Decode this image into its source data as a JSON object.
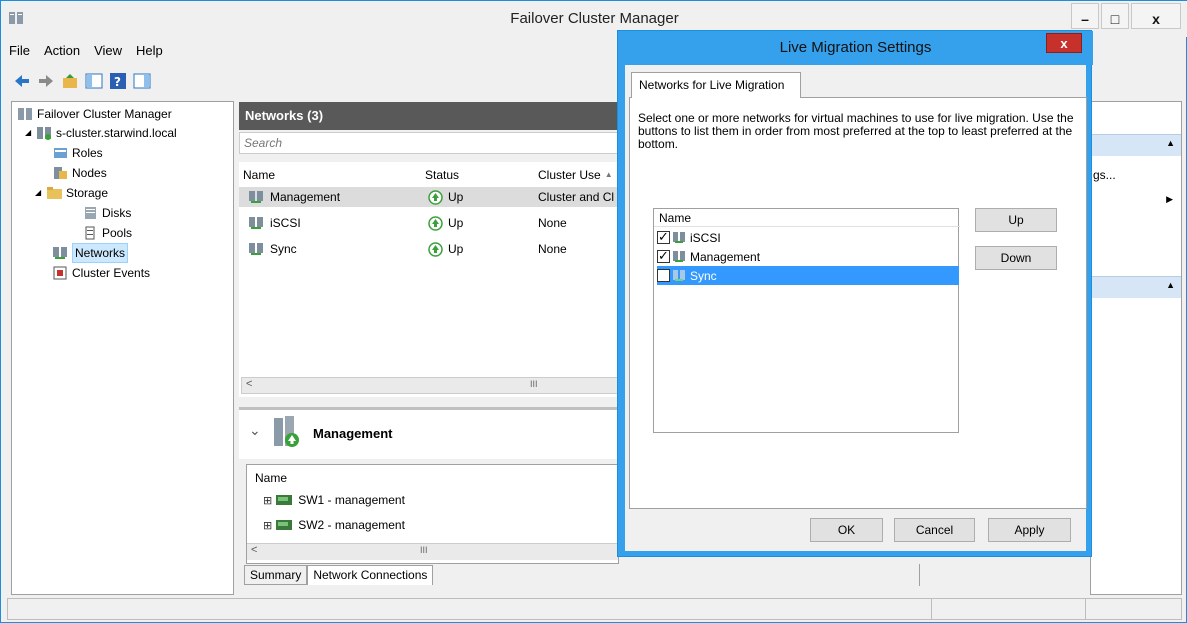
{
  "main_window": {
    "title": "Failover Cluster Manager",
    "controls": {
      "minimize": "–",
      "maximize": "□",
      "close": "x"
    }
  },
  "menu": [
    "File",
    "Action",
    "View",
    "Help"
  ],
  "toolbar_icons": [
    "back-arrow-icon",
    "forward-arrow-icon",
    "folder-up-icon",
    "show-hide-tree-icon",
    "help-icon",
    "show-hide-action-icon"
  ],
  "tree": {
    "items": [
      {
        "label": "Failover Cluster Manager",
        "icon": "cluster-manager-icon",
        "expander": ""
      },
      {
        "label": "s-cluster.starwind.local",
        "icon": "cluster-icon",
        "expander": "◢"
      },
      {
        "label": "Roles",
        "icon": "roles-icon",
        "expander": ""
      },
      {
        "label": "Nodes",
        "icon": "nodes-icon",
        "expander": ""
      },
      {
        "label": "Storage",
        "icon": "storage-folder-icon",
        "expander": "◢"
      },
      {
        "label": "Disks",
        "icon": "disks-icon",
        "expander": ""
      },
      {
        "label": "Pools",
        "icon": "pools-icon",
        "expander": ""
      },
      {
        "label": "Networks",
        "icon": "networks-icon",
        "expander": ""
      },
      {
        "label": "Cluster Events",
        "icon": "cluster-events-icon",
        "expander": ""
      }
    ]
  },
  "networks_panel": {
    "title": "Networks (3)",
    "search_placeholder": "Search",
    "columns": [
      "Name",
      "Status",
      "Cluster Use"
    ],
    "sort_indicator": "▲",
    "rows": [
      {
        "name": "Management",
        "status": "Up",
        "cluster_use": "Cluster and Cl"
      },
      {
        "name": "iSCSI",
        "status": "Up",
        "cluster_use": "None"
      },
      {
        "name": "Sync",
        "status": "Up",
        "cluster_use": "None"
      }
    ],
    "scroll_glyph": "III",
    "scroll_left": "<"
  },
  "detail_panel": {
    "title": "Management",
    "collapse_glyph": "⌄",
    "list_header": "Name",
    "items": [
      "SW1 - management",
      "SW2 - management"
    ],
    "expand_glyph": "⊞",
    "tabs": [
      "Summary",
      "Network Connections"
    ],
    "active_tab": "Network Connections"
  },
  "actions_pane": {
    "partial_text": "gs...",
    "collapse_glyph": "▲",
    "submenu_glyph": "▶"
  },
  "dialog": {
    "title": "Live Migration Settings",
    "close_label": "x",
    "tab": "Networks for Live Migration",
    "description": "Select one or more networks for virtual machines to use for live migration. Use the buttons to list them in order from most preferred at the top to least preferred at the bottom.",
    "list_header": "Name",
    "networks": [
      {
        "name": "iSCSI",
        "checked": true,
        "selected": false
      },
      {
        "name": "Management",
        "checked": true,
        "selected": false
      },
      {
        "name": "Sync",
        "checked": false,
        "selected": true
      }
    ],
    "up_button": "Up",
    "down_button": "Down",
    "ok_button": "OK",
    "cancel_button": "Cancel",
    "apply_button": "Apply"
  },
  "colors": {
    "accent": "#35a0eb",
    "selection": "#3399ff",
    "header_dark": "#595959",
    "close_red": "#c7312b",
    "status_up_green": "#3aa13a"
  }
}
